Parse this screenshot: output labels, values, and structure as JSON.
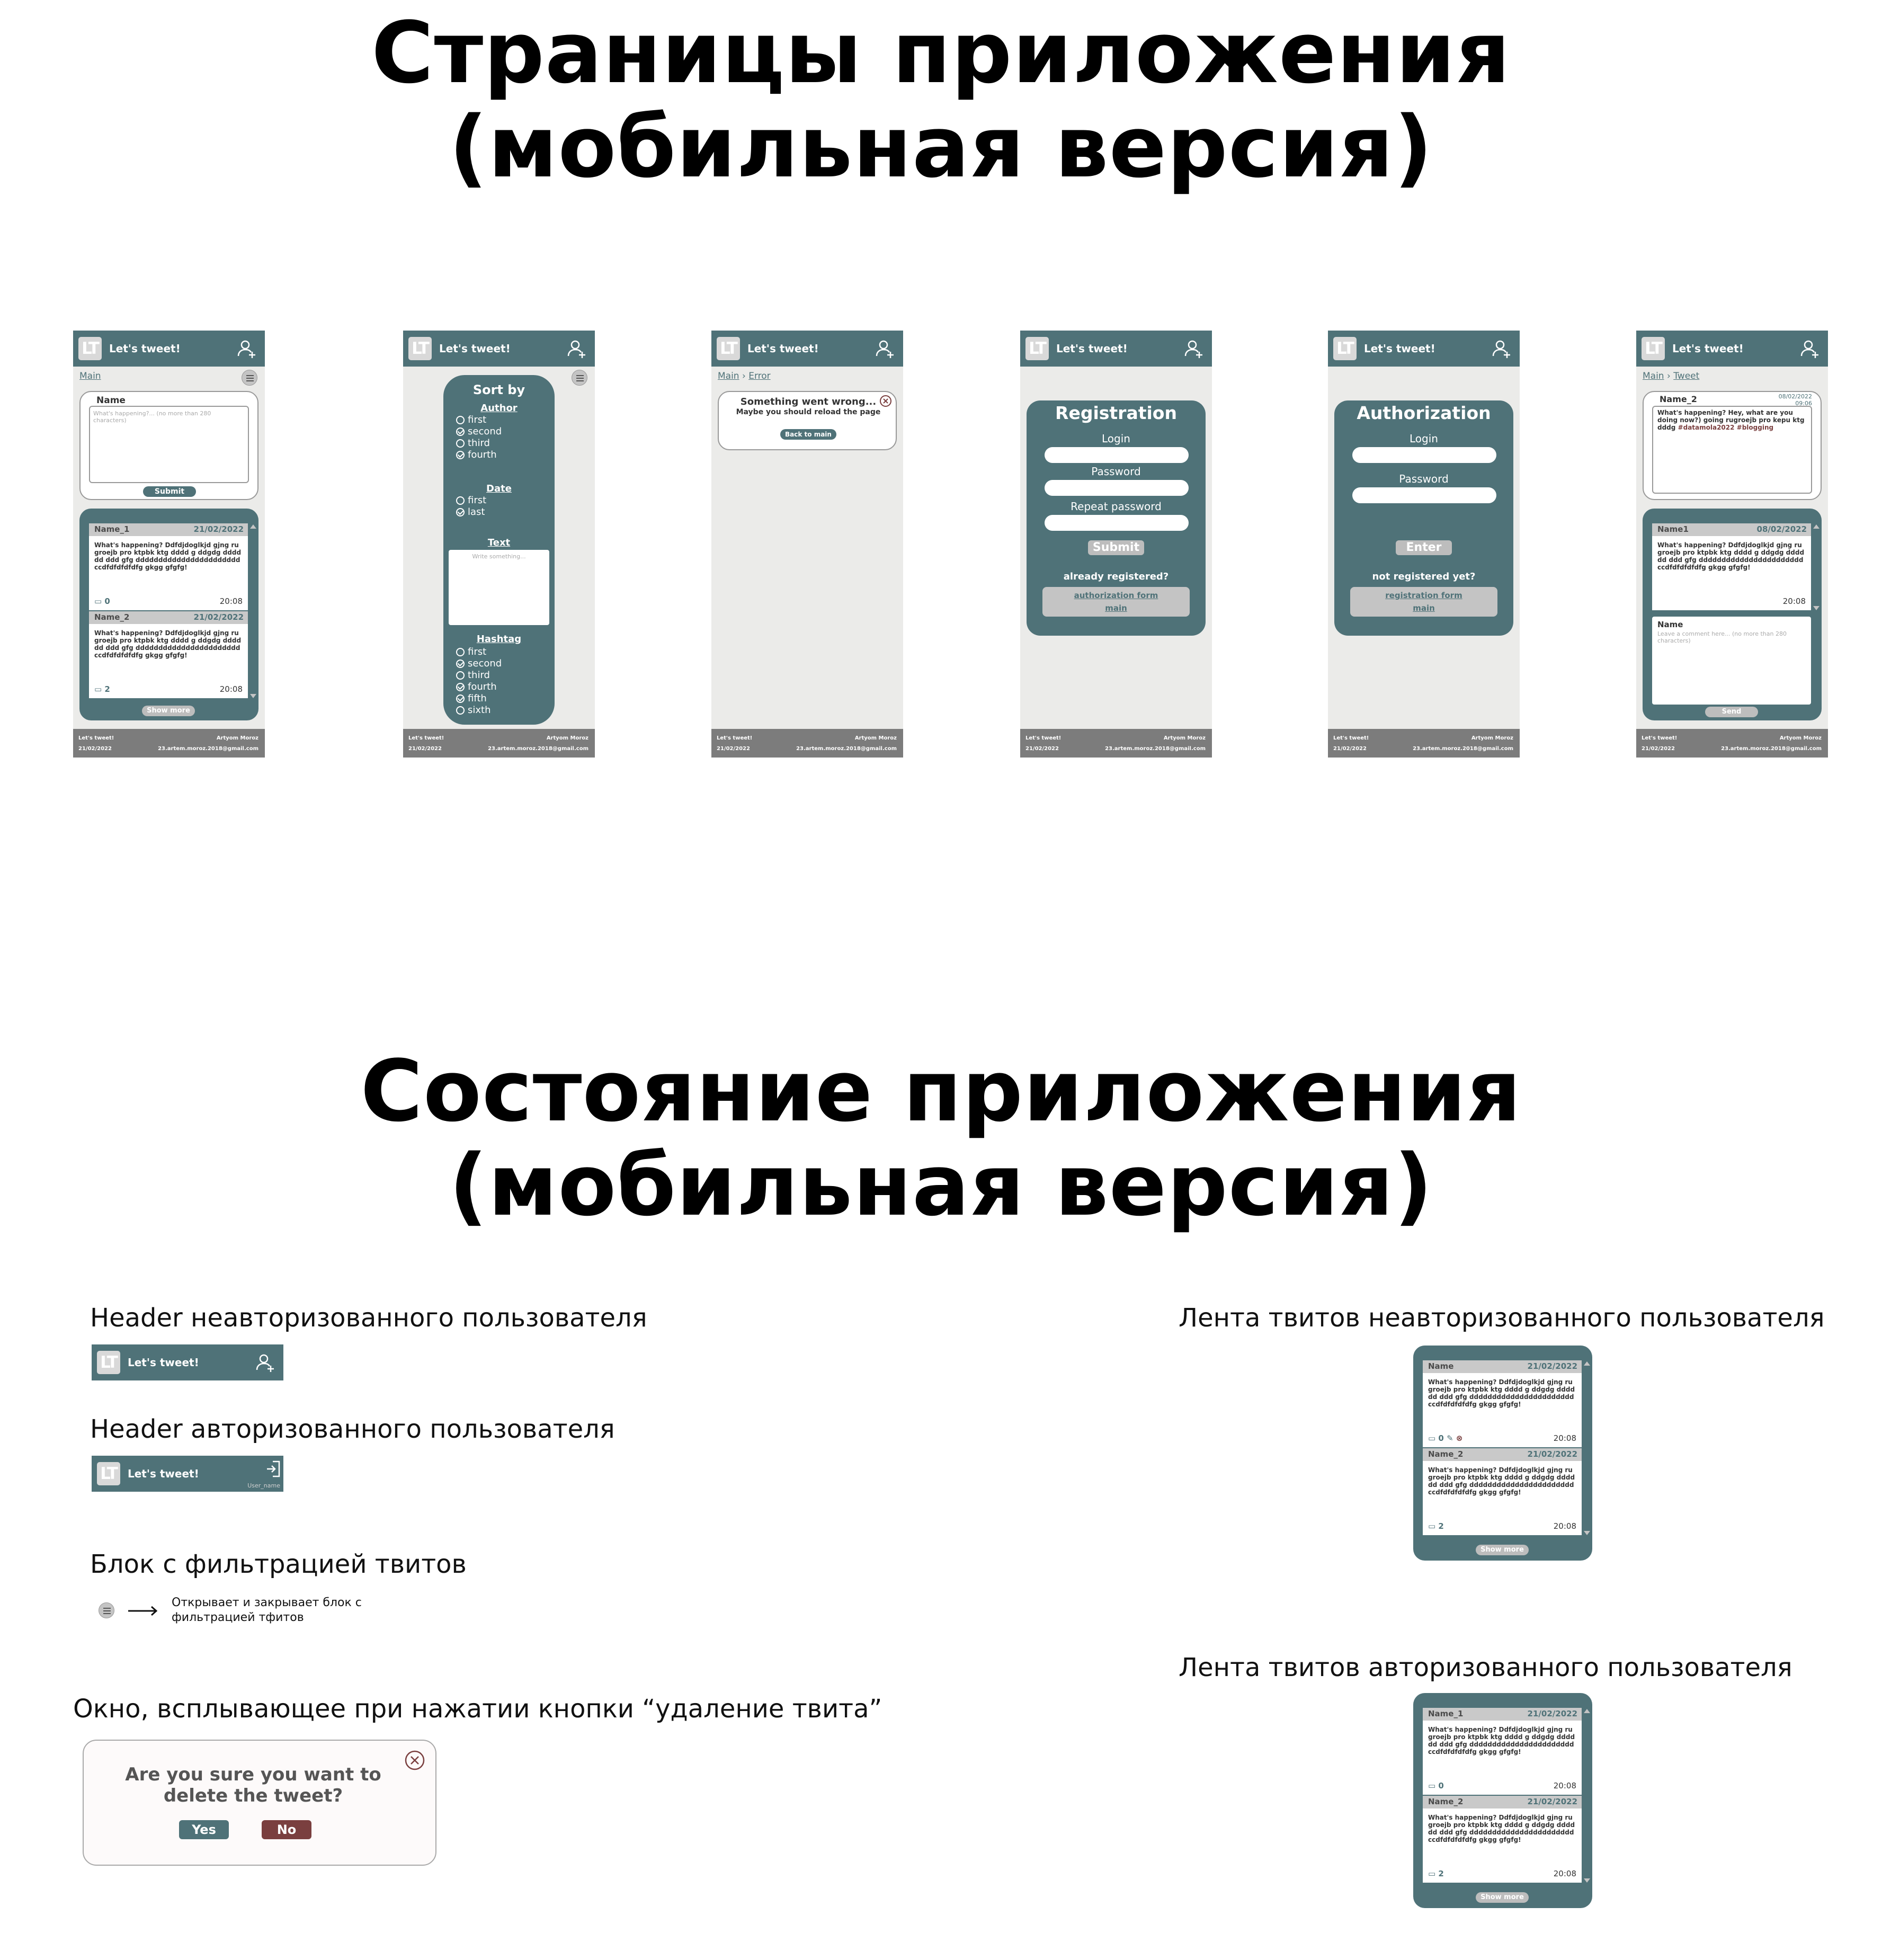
{
  "titles": {
    "pages_line1": "Страницы приложения",
    "pages_line2": "(мобильная версия)",
    "state_line1": "Состояние приложения",
    "state_line2": "(мобильная версия)"
  },
  "common": {
    "logo": "LT",
    "app_name": "Let's tweet!",
    "footer_left_1": "Let's tweet!",
    "footer_left_2": "21/02/2022",
    "footer_right_1": "Artyom Moroz",
    "footer_right_2": "23.artem.moroz.2018@gmail.com",
    "crumb_main": "Main"
  },
  "main_page": {
    "compose_name": "Name",
    "compose_placeholder": "What's happening?... (no more than 280 characters)",
    "submit": "Submit",
    "tweets": [
      {
        "name": "Name_1",
        "date": "21/02/2022",
        "text": "What's happening?  Ddfdjdoglkjd gjng rugroejb  pro ktpbk ktg dddd g ddgdg dddddd ddd gfg ddddddddddddddddddddddd ccdfdfdfdfdfg gkgg gfgfg!",
        "comments": "0",
        "time": "20:08"
      },
      {
        "name": "Name_2",
        "date": "21/02/2022",
        "text": "What's happening?  Ddfdjdoglkjd gjng rugroejb  pro ktpbk ktg dddd g ddgdg dddddd ddd gfg ddddddddddddddddddddddd ccdfdfdfdfdfg gkgg gfgfg!",
        "comments": "2",
        "time": "20:08"
      }
    ],
    "show_more": "Show more"
  },
  "sort_page": {
    "title": "Sort by",
    "author_label": "Author",
    "author_options": [
      {
        "label": "first",
        "checked": false
      },
      {
        "label": "second",
        "checked": true
      },
      {
        "label": "third",
        "checked": false
      },
      {
        "label": "fourth",
        "checked": true
      }
    ],
    "date_label": "Date",
    "date_options": [
      {
        "label": "first",
        "checked": false
      },
      {
        "label": "last",
        "checked": true
      }
    ],
    "text_label": "Text",
    "text_placeholder": "Write something...",
    "hashtag_label": "Hashtag",
    "hashtag_options": [
      {
        "label": "first",
        "checked": false
      },
      {
        "label": "second",
        "checked": true
      },
      {
        "label": "third",
        "checked": false
      },
      {
        "label": "fourth",
        "checked": true
      },
      {
        "label": "fifth",
        "checked": true
      },
      {
        "label": "sixth",
        "checked": false
      }
    ]
  },
  "error_page": {
    "crumb_current": "Error",
    "title": "Something went wrong...",
    "subtitle": "Maybe you should reload the page",
    "button": "Back to main"
  },
  "registration_page": {
    "title": "Registration",
    "login": "Login",
    "password": "Password",
    "repeat_password": "Repeat password",
    "submit": "Submit",
    "question": "already registered?",
    "link_1": "authorization form",
    "link_2": "main"
  },
  "authorization_page": {
    "title": "Authorization",
    "login": "Login",
    "password": "Password",
    "enter": "Enter",
    "question": "not registered yet?",
    "link_1": "registration form",
    "link_2": "main"
  },
  "tweet_page": {
    "crumb_current": "Tweet",
    "name": "Name_2",
    "date": "08/02/2022",
    "time_small": "09:06",
    "text": "What's happening? Hey, what are you doing now?) going rugroejb  pro kepu ktg dddg ",
    "hashtags": "#datamola2022 #blogging",
    "comment_name": "Name1",
    "comment_date": "08/02/2022",
    "comment_text": "What's happening?  Ddfdjdoglkjd gjng rugroejb  pro ktpbk ktg dddd g ddgdg dddddd ddd gfg ddddddddddddddddddddddd ccdfdfdfdfdfg gkgg gfgfg!",
    "comment_time": "20:08",
    "new_comment_name": "Name",
    "new_comment_placeholder": "Leave a comment here... (no more than 280 characters)",
    "send": "Send"
  },
  "states": {
    "header_unauth_label": "Header неавторизованного пользователя",
    "header_auth_label": "Header авторизованного пользователя",
    "user_name": "User_name",
    "filter_label": "Блок с фильтрацией твитов",
    "filter_note": "Открывает и закрывает блок с фильтрацией тфитов",
    "delete_label": "Окно, всплывающее при нажатии кнопки “удаление твита”",
    "delete_question_1": "Are you sure you want to",
    "delete_question_2": "delete the tweet?",
    "yes": "Yes",
    "no": "No",
    "feed_unauth_label": "Лента твитов неавторизованного пользователя",
    "feed_auth_label": "Лента твитов авторизованного пользователя",
    "feed_unauth": [
      {
        "name": "Name",
        "date": "21/02/2022",
        "text": "What's happening?  Ddfdjdoglkjd gjng rugroejb  pro ktpbk ktg dddd g ddgdg dddddd ddd gfg ddddddddddddddddddddddd ccdfdfdfdfdfg gkgg gfgfg!",
        "comments": "0",
        "time": "20:08"
      },
      {
        "name": "Name_2",
        "date": "21/02/2022",
        "text": "What's happening?  Ddfdjdoglkjd gjng rugroejb  pro ktpbk ktg dddd g ddgdg dddddd ddd gfg ddddddddddddddddddddddd ccdfdfdfdfdfg gkgg gfgfg!",
        "comments": "2",
        "time": "20:08"
      }
    ],
    "feed_auth": [
      {
        "name": "Name_1",
        "date": "21/02/2022",
        "text": "What's happening?  Ddfdjdoglkjd gjng rugroejb  pro ktpbk ktg dddd g ddgdg dddddd ddd gfg ddddddddddddddddddddddd ccdfdfdfdfdfg gkgg gfgfg!",
        "comments": "0",
        "time": "20:08"
      },
      {
        "name": "Name_2",
        "date": "21/02/2022",
        "text": "What's happening?  Ddfdjdoglkjd gjng rugroejb  pro ktpbk ktg dddd g ddgdg dddddd ddd gfg ddddddddddddddddddddddd ccdfdfdfdfdfg gkgg gfgfg!",
        "comments": "2",
        "time": "20:08"
      }
    ],
    "show_more": "Show more"
  },
  "colors": {
    "primary": "#4f7278",
    "danger": "#7a3f3f",
    "panel_bg": "#ebebe9",
    "footer": "#7c7c7c"
  }
}
